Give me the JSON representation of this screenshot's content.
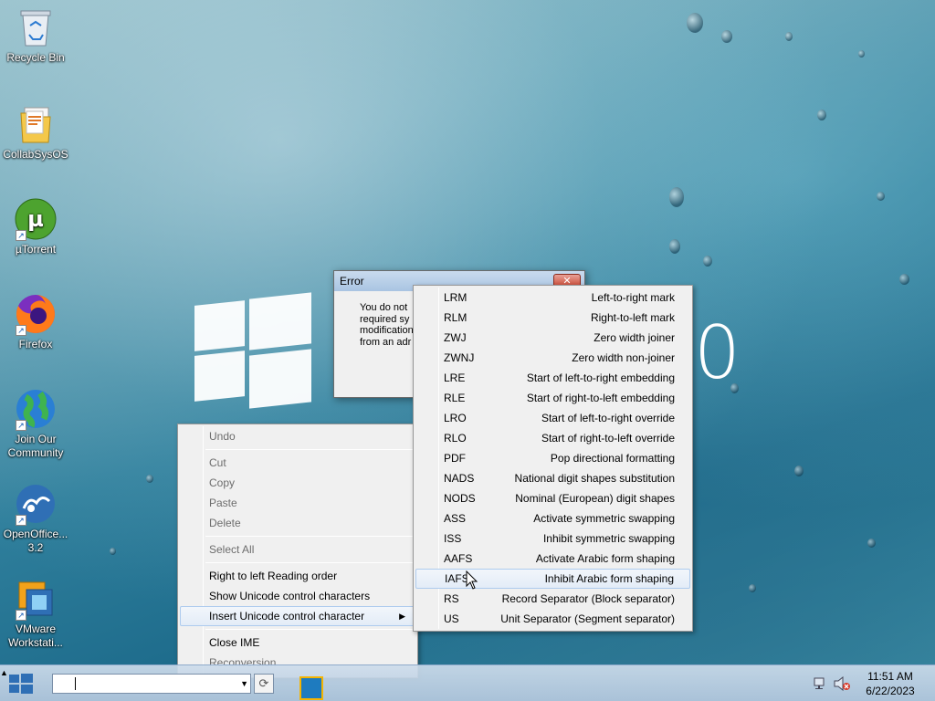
{
  "desktop": {
    "icons": [
      {
        "label": "Recycle Bin",
        "icon": "recycle-bin-icon"
      },
      {
        "label": "CollabSysOS",
        "icon": "folder-icon"
      },
      {
        "label": "µTorrent",
        "icon": "utorrent-icon"
      },
      {
        "label": "Firefox",
        "icon": "firefox-icon"
      },
      {
        "label": "Join Our Community",
        "icon": "globe-icon"
      },
      {
        "label": "OpenOffice... 3.2",
        "icon": "openoffice-icon"
      },
      {
        "label": "VMware Workstati...",
        "icon": "vmware-icon"
      }
    ],
    "wallpaper_text": "0"
  },
  "error_dialog": {
    "title": "Error",
    "close_label": "✕",
    "message": "You do not\nrequired sy\nmodification\nfrom an adr"
  },
  "context_menu": {
    "items": [
      {
        "label": "Undo",
        "enabled": false
      },
      {
        "label": "Cut",
        "enabled": false
      },
      {
        "label": "Copy",
        "enabled": false
      },
      {
        "label": "Paste",
        "enabled": false
      },
      {
        "label": "Delete",
        "enabled": false
      },
      {
        "label": "Select All",
        "enabled": false
      },
      {
        "label": "Right to left Reading order",
        "enabled": true
      },
      {
        "label": "Show Unicode control characters",
        "enabled": true
      },
      {
        "label": "Insert Unicode control character",
        "enabled": true,
        "submenu_arrow": "▶"
      },
      {
        "label": "Close IME",
        "enabled": true
      },
      {
        "label": "Reconversion",
        "enabled": false
      }
    ]
  },
  "unicode_submenu": {
    "items": [
      {
        "code": "LRM",
        "desc": "Left-to-right mark"
      },
      {
        "code": "RLM",
        "desc": "Right-to-left mark"
      },
      {
        "code": "ZWJ",
        "desc": "Zero width joiner"
      },
      {
        "code": "ZWNJ",
        "desc": "Zero width non-joiner"
      },
      {
        "code": "LRE",
        "desc": "Start of left-to-right embedding"
      },
      {
        "code": "RLE",
        "desc": "Start of right-to-left embedding"
      },
      {
        "code": "LRO",
        "desc": "Start of left-to-right override"
      },
      {
        "code": "RLO",
        "desc": "Start of right-to-left override"
      },
      {
        "code": "PDF",
        "desc": "Pop directional formatting"
      },
      {
        "code": "NADS",
        "desc": "National digit shapes substitution"
      },
      {
        "code": "NODS",
        "desc": "Nominal (European) digit shapes"
      },
      {
        "code": "ASS",
        "desc": "Activate symmetric swapping"
      },
      {
        "code": "ISS",
        "desc": "Inhibit symmetric swapping"
      },
      {
        "code": "AAFS",
        "desc": "Activate Arabic form shaping"
      },
      {
        "code": "IAFS",
        "desc": "Inhibit Arabic form shaping"
      },
      {
        "code": "RS",
        "desc": "Record Separator (Block separator)"
      },
      {
        "code": "US",
        "desc": "Unit Separator (Segment separator)"
      }
    ],
    "highlighted_index": 14
  },
  "taskbar": {
    "address_value": "",
    "dropdown_icon": "▼",
    "refresh_icon": "⟳",
    "tray_icons": [
      "show-hidden-icons-icon",
      "network-icon",
      "volume-muted-icon"
    ],
    "tray_chevron": "▲",
    "time": "11:51 AM",
    "date": "6/22/2023"
  }
}
